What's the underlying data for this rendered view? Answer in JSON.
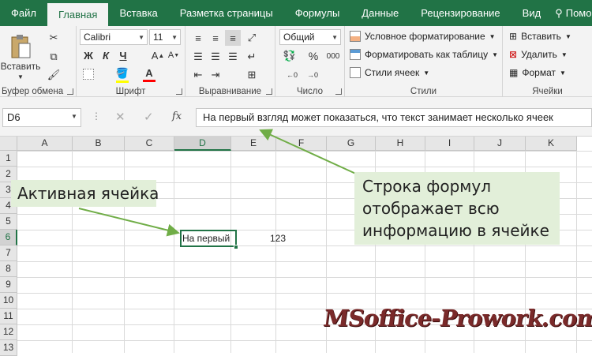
{
  "tabs": [
    "Файл",
    "Главная",
    "Вставка",
    "Разметка страницы",
    "Формулы",
    "Данные",
    "Рецензирование",
    "Вид",
    "Помощн"
  ],
  "help_icon": "lightbulb-icon",
  "ribbon": {
    "clipboard": {
      "paste": "Вставить",
      "label": "Буфер обмена"
    },
    "font": {
      "name": "Calibri",
      "size": "11",
      "bold": "Ж",
      "italic": "К",
      "underline": "Ч",
      "label": "Шрифт",
      "fill_color": "#ffff00",
      "font_color": "#ff0000"
    },
    "align": {
      "label": "Выравнивание"
    },
    "number": {
      "format": "Общий",
      "percent": "%",
      "thousands": "000",
      "label": "Число"
    },
    "styles": {
      "cond": "Условное форматирование",
      "table": "Форматировать как таблицу",
      "cell": "Стили ячеек",
      "label": "Стили"
    },
    "cells": {
      "insert": "Вставить",
      "delete": "Удалить",
      "format": "Формат",
      "label": "Ячейки"
    }
  },
  "formula_bar": {
    "name_box": "D6",
    "fx": "fx",
    "content": "На первый взгляд может показаться, что текст занимает несколько ячеек"
  },
  "columns": [
    "A",
    "B",
    "C",
    "D",
    "E",
    "F",
    "G",
    "H",
    "I",
    "J",
    "K"
  ],
  "rows": [
    "1",
    "2",
    "3",
    "4",
    "5",
    "6",
    "7",
    "8",
    "9",
    "10",
    "11",
    "12",
    "13"
  ],
  "cells": {
    "D6": "На первый",
    "E6": "123"
  },
  "callouts": {
    "active": "Активная ячейка",
    "formula": "Строка формул отображает всю информацию в ячейке"
  },
  "watermark": "MSoffice-Prowork.com",
  "colors": {
    "accent": "#217346",
    "callout_bg": "#e2efd9",
    "arrow": "#70ad47"
  }
}
